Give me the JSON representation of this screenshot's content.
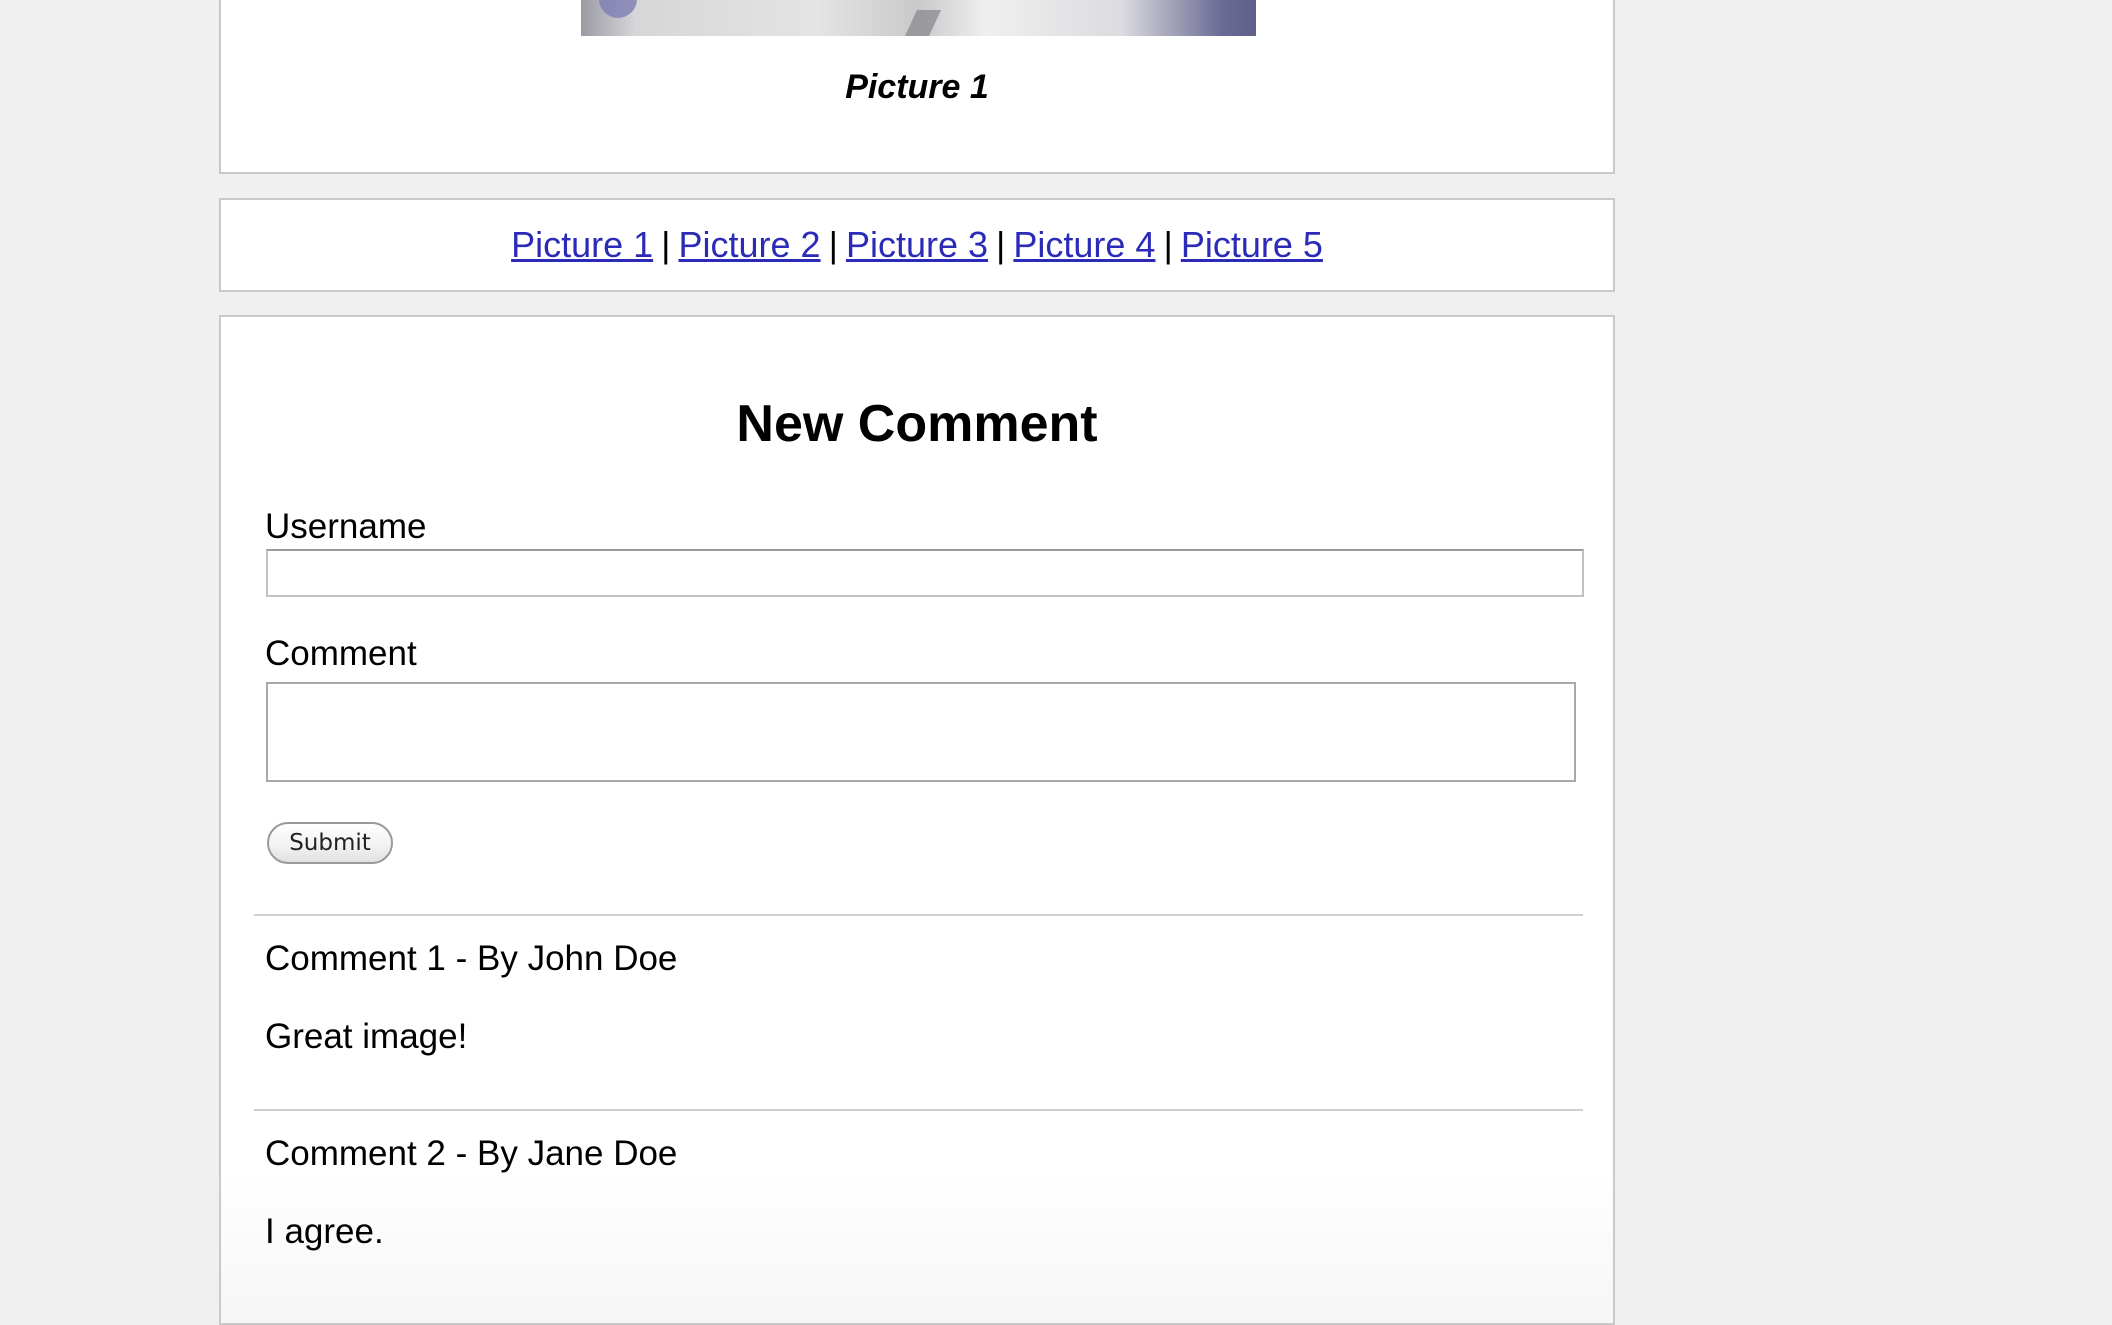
{
  "picture": {
    "caption": "Picture 1"
  },
  "nav": {
    "links": [
      "Picture 1",
      "Picture 2",
      "Picture 3",
      "Picture 4",
      "Picture 5"
    ],
    "separator": "|"
  },
  "form": {
    "heading": "New Comment",
    "username_label": "Username",
    "username_value": "",
    "comment_label": "Comment",
    "comment_value": "",
    "submit_label": "Submit"
  },
  "comments": [
    {
      "title": "Comment 1 - By John Doe",
      "body": "Great image!"
    },
    {
      "title": "Comment 2 - By Jane Doe",
      "body": "I agree."
    }
  ],
  "colors": {
    "page_background": "#f0f0f1",
    "panel_background": "#ffffff",
    "link": "#2b2bb8",
    "panel_border": "#c9c9c9"
  }
}
